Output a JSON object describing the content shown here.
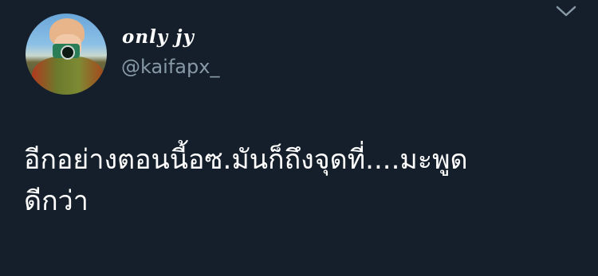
{
  "tweet": {
    "display_name": "only jy",
    "handle": "@kaifapx_",
    "text_lines": [
      "อีกอย่างตอนนี้อซ.มันก็ถึงจุดที่....มะพูด",
      "ดีกว่า"
    ]
  },
  "icons": {
    "more": "chevron-down-icon",
    "avatar": "profile-photo"
  },
  "colors": {
    "background": "#151f2b",
    "text": "#ffffff",
    "secondary_text": "#8899a6"
  }
}
